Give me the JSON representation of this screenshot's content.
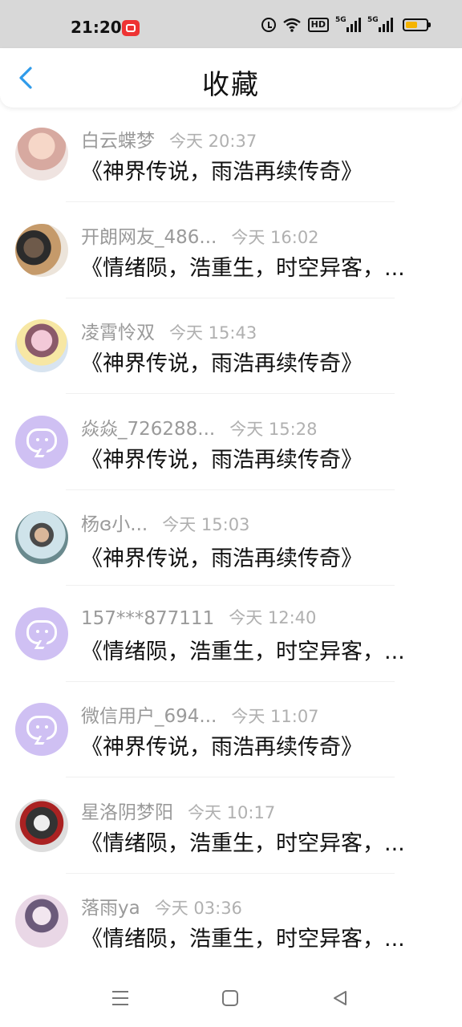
{
  "status_bar": {
    "time": "21:20",
    "icons": [
      "app-notification-icon",
      "alarm-icon",
      "wifi-icon",
      "hd-icon",
      "signal-5g-icon",
      "signal-5g-icon",
      "battery-icon"
    ],
    "hd_label": "HD",
    "network_label": "5G",
    "battery_level": 0.6
  },
  "header": {
    "back_icon": "chevron-left-icon",
    "title": "收藏",
    "accent_color": "#2f9bea"
  },
  "favorites": [
    {
      "user": "白云蝶梦",
      "time": "今天 20:37",
      "book": "《神界传说，雨浩再续传奇》",
      "avatar": "photo"
    },
    {
      "user": "开朗网友_486...",
      "time": "今天 16:02",
      "book": "《情绪陨，浩重生，时空异客，...",
      "avatar": "photo"
    },
    {
      "user": "凌霄怜双",
      "time": "今天 15:43",
      "book": "《神界传说，雨浩再续传奇》",
      "avatar": "photo"
    },
    {
      "user": "焱焱_726288...",
      "time": "今天 15:28",
      "book": "《神界传说，雨浩再续传奇》",
      "avatar": "default"
    },
    {
      "user": "杨ɞ小...",
      "time": "今天 15:03",
      "book": "《神界传说，雨浩再续传奇》",
      "avatar": "photo"
    },
    {
      "user": "157***877111",
      "time": "今天 12:40",
      "book": "《情绪陨，浩重生，时空异客，...",
      "avatar": "default"
    },
    {
      "user": "微信用户_694...",
      "time": "今天 11:07",
      "book": "《神界传说，雨浩再续传奇》",
      "avatar": "default"
    },
    {
      "user": "星洛阴梦阳",
      "time": "今天 10:17",
      "book": "《情绪陨，浩重生，时空异客，...",
      "avatar": "photo"
    },
    {
      "user": "落雨ya",
      "time": "今天 03:36",
      "book": "《情绪陨，浩重生，时空异客，...",
      "avatar": "photo"
    }
  ],
  "nav_bar": {
    "icons": [
      "menu-icon",
      "home-icon",
      "back-triangle-icon"
    ]
  }
}
